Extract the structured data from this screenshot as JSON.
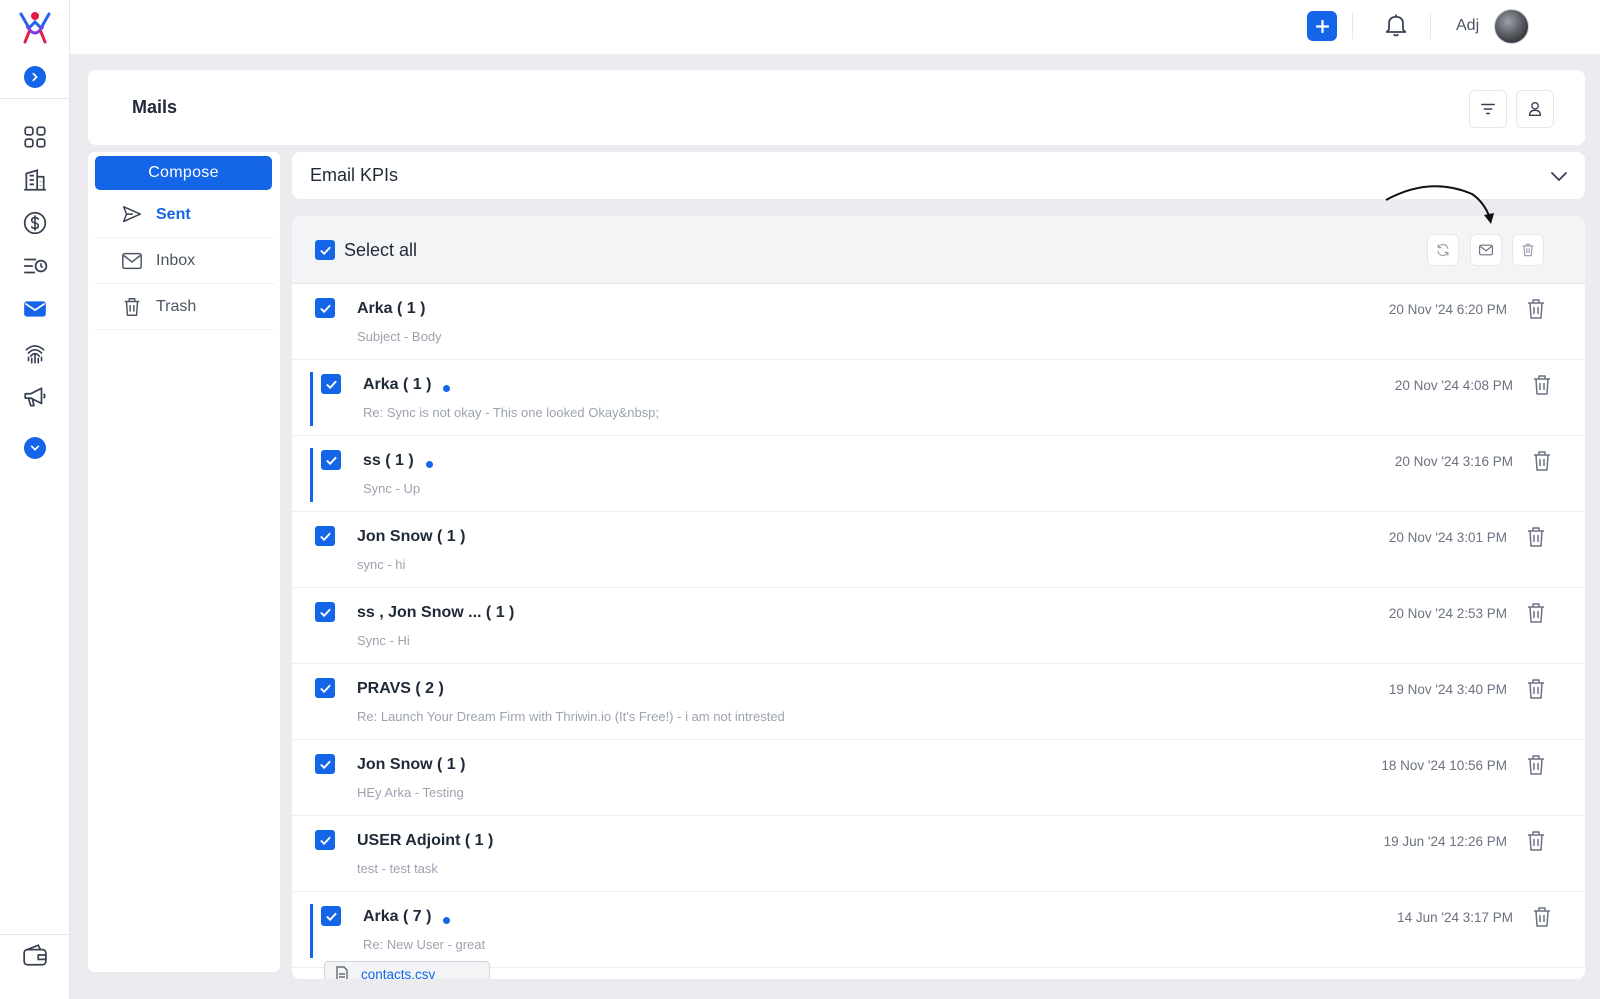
{
  "app": {
    "user_name": "Adj",
    "accent_color": "#1565e8"
  },
  "rail": {
    "icons": [
      "logo-icon",
      "expand-icon",
      "dashboard-grid-icon",
      "building-icon",
      "dollar-icon",
      "task-list-clock-icon",
      "mail-icon",
      "fingerprint-icon",
      "megaphone-icon",
      "collapse-icon",
      "wallet-icon"
    ]
  },
  "header": {
    "title": "Mails"
  },
  "mail_nav": {
    "compose_label": "Compose",
    "items": [
      {
        "label": "Sent",
        "icon": "send-icon",
        "active": true
      },
      {
        "label": "Inbox",
        "icon": "inbox-icon",
        "active": false
      },
      {
        "label": "Trash",
        "icon": "trash-icon",
        "active": false
      }
    ]
  },
  "kpi": {
    "title": "Email KPIs"
  },
  "toolbar": {
    "select_all_label": "Select all",
    "select_all_checked": true
  },
  "mails": [
    {
      "sender": "Arka ( 1 )",
      "snippet": "Subject -  Body",
      "date": "20 Nov '24 6:20 PM",
      "unread": false,
      "checked": true
    },
    {
      "sender": "Arka ( 1 )",
      "snippet": "Re: Sync is not okay -  This one looked Okay&nbsp;",
      "date": "20 Nov '24 4:08 PM",
      "unread": true,
      "checked": true
    },
    {
      "sender": "ss ( 1 )",
      "snippet": "Sync -  Up",
      "date": "20 Nov '24 3:16 PM",
      "unread": true,
      "checked": true
    },
    {
      "sender": "Jon Snow ( 1 )",
      "snippet": "sync -  hi",
      "date": "20 Nov '24 3:01 PM",
      "unread": false,
      "checked": true
    },
    {
      "sender": "ss ,   Jon Snow ... ( 1 )",
      "snippet": "Sync -  Hi",
      "date": "20 Nov '24 2:53 PM",
      "unread": false,
      "checked": true
    },
    {
      "sender": "PRAVS ( 2 )",
      "snippet": "Re: Launch Your Dream Firm with Thriwin.io (It's Free!) -  i am not intrested",
      "date": "19 Nov '24 3:40 PM",
      "unread": false,
      "checked": true
    },
    {
      "sender": "Jon Snow ( 1 )",
      "snippet": "HEy Arka -  Testing",
      "date": "18 Nov '24 10:56 PM",
      "unread": false,
      "checked": true
    },
    {
      "sender": "USER Adjoint ( 1 )",
      "snippet": "test -  test task",
      "date": "19 Jun '24 12:26 PM",
      "unread": false,
      "checked": true
    },
    {
      "sender": "Arka ( 7 )",
      "snippet": "Re: New User -  great",
      "date": "14 Jun '24 3:17 PM",
      "unread": true,
      "checked": true
    }
  ],
  "attachment": {
    "name": "contacts.csv"
  }
}
